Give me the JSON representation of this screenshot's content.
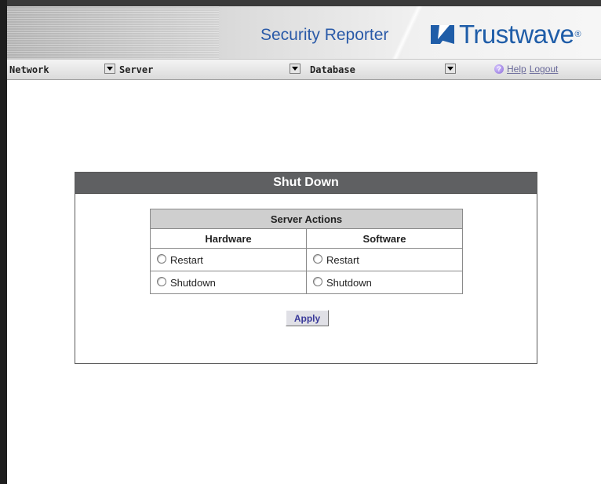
{
  "header": {
    "product_title": "Security Reporter",
    "brand_name": "Trustwave",
    "brand_reg": "®"
  },
  "nav": {
    "selects": [
      {
        "label": "Network"
      },
      {
        "label": "Server"
      },
      {
        "label": "Database"
      }
    ],
    "help_label": "Help",
    "logout_label": "Logout"
  },
  "panel": {
    "title": "Shut Down",
    "table": {
      "caption": "Server Actions",
      "columns": [
        "Hardware",
        "Software"
      ],
      "rows": [
        [
          "Restart",
          "Restart"
        ],
        [
          "Shutdown",
          "Shutdown"
        ]
      ]
    },
    "apply_label": "Apply"
  },
  "colors": {
    "brand_blue": "#1f5da8",
    "product_blue": "#2a5aa8",
    "panel_header": "#5f6062",
    "table_caption_bg": "#cfcfcf"
  }
}
